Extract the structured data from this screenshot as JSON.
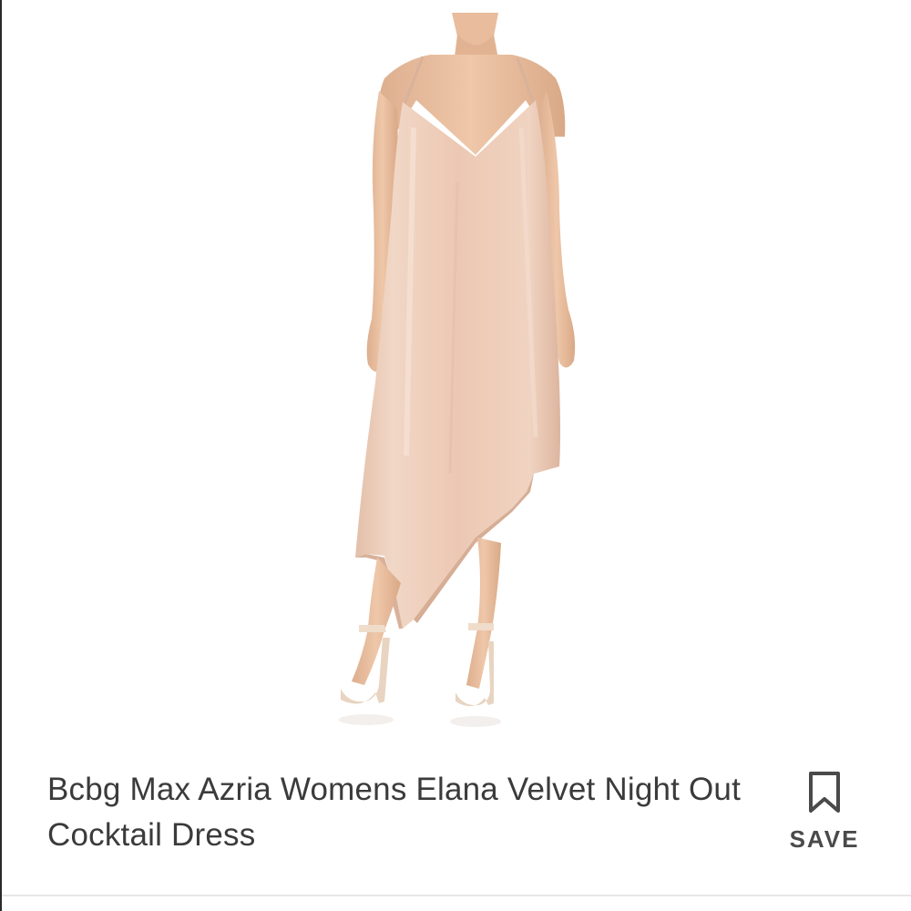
{
  "product": {
    "title": "Bcbg Max Azria Womens Elana Velvet Night Out Cocktail Dress",
    "save_label": "SAVE"
  },
  "icons": {
    "save": "bookmark-icon"
  },
  "colors": {
    "dress": "#ecc9b4",
    "skin": "#e9bfa0",
    "text": "#3b3b3b"
  }
}
